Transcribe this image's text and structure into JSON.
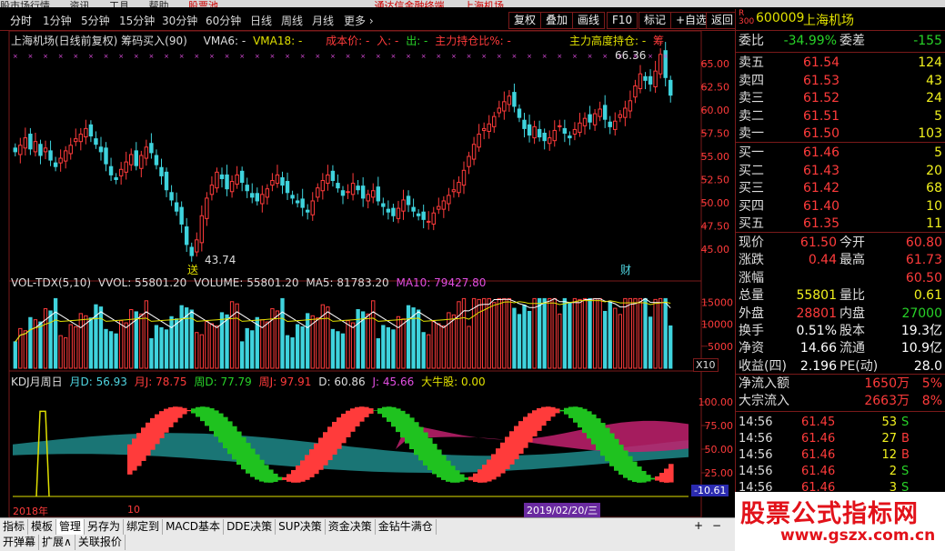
{
  "menu": {
    "items": [
      "股市场行情",
      "资讯",
      "工具",
      "帮助",
      "股票池"
    ],
    "center_items": [
      "通达信金融终端",
      "上海机场"
    ]
  },
  "periods": [
    "分时",
    "1分钟",
    "5分钟",
    "15分钟",
    "30分钟",
    "60分钟",
    "日线",
    "周线",
    "月线",
    "更多 ›"
  ],
  "toolbar": [
    "复权",
    "叠加",
    "画线",
    "F10",
    "标记",
    "+自选",
    "返回"
  ],
  "main_info": {
    "title": "上海机场(日线前复权) 筹码买入(90)",
    "vma6": "VMA6: -",
    "vma18": "VMA18: -",
    "cost": "成本价: -",
    "in": "入: -",
    "out": "出: -",
    "main_ratio": "主力持仓比%: -",
    "main_height": "主力高度持仓: -",
    "chip": "筹"
  },
  "price_axis": [
    "65.00",
    "62.50",
    "60.00",
    "57.50",
    "55.00",
    "52.50",
    "50.00",
    "47.50",
    "45.00"
  ],
  "annotations": {
    "high": "66.36",
    "low": "43.74",
    "low_tag": "送",
    "fin_tag": "财"
  },
  "vol_info": {
    "title": "VOL-TDX(5,10)",
    "vvol": "VVOL: 55801.20",
    "volume": "VOLUME: 55801.20",
    "ma5": "MA5: 81783.20",
    "ma10": "MA10: 79427.80"
  },
  "vol_axis": [
    "15000",
    "10000",
    "5000"
  ],
  "vol_unit": "X10",
  "kdj_info": {
    "title": "KDJ月周日",
    "h": "月D: 56.93",
    "mj": "月J: 78.75",
    "wd": "周D: 77.79",
    "wj": "周J: 97.91",
    "d": "D: 60.86",
    "j": "J: 45.66",
    "bull": "大牛股: 0.00"
  },
  "kdj_axis": [
    "100.00",
    "75.00",
    "50.00",
    "25.00"
  ],
  "kdj_value": "-10.61",
  "date_axis": {
    "year": "2018年",
    "month": "10",
    "cursor_date": "2019/02/20/三"
  },
  "bottom_tabs": [
    "指标",
    "模板",
    "管理",
    "另存为",
    "绑定到",
    "MACD基本",
    "DDE决策",
    "SUP决策",
    "资金决策",
    "金钻牛满仓"
  ],
  "bottom_tabs2": [
    "开弹幕",
    "扩展∧",
    "关联报价"
  ],
  "stock": {
    "code": "600009",
    "name": "上海机场",
    "prefix_r": "R",
    "prefix_300": "300"
  },
  "quote": {
    "webi_label": "委比",
    "webi": "-34.99%",
    "wecha_label": "委差",
    "wecha": "-155",
    "asks": [
      {
        "label": "卖五",
        "price": "61.54",
        "vol": "124"
      },
      {
        "label": "卖四",
        "price": "61.53",
        "vol": "43"
      },
      {
        "label": "卖三",
        "price": "61.52",
        "vol": "24"
      },
      {
        "label": "卖二",
        "price": "61.51",
        "vol": "5"
      },
      {
        "label": "卖一",
        "price": "61.50",
        "vol": "103"
      }
    ],
    "bids": [
      {
        "label": "买一",
        "price": "61.46",
        "vol": "5"
      },
      {
        "label": "买二",
        "price": "61.43",
        "vol": "20"
      },
      {
        "label": "买三",
        "price": "61.42",
        "vol": "68"
      },
      {
        "label": "买四",
        "price": "61.40",
        "vol": "10"
      },
      {
        "label": "买五",
        "price": "61.35",
        "vol": "11"
      }
    ],
    "stats": [
      {
        "l1": "现价",
        "v1": "61.50",
        "c1": "red",
        "l2": "今开",
        "v2": "60.80",
        "c2": "red"
      },
      {
        "l1": "涨跌",
        "v1": "0.44",
        "c1": "red",
        "l2": "最高",
        "v2": "61.73",
        "c2": "red"
      },
      {
        "l1": "涨幅",
        "v1": "",
        "c1": "red",
        "l2": "",
        "v2": "60.50",
        "c2": "red"
      },
      {
        "l1": "总量",
        "v1": "55801",
        "c1": "yellow",
        "l2": "量比",
        "v2": "0.61",
        "c2": "yellow"
      },
      {
        "l1": "外盘",
        "v1": "28801",
        "c1": "red",
        "l2": "内盘",
        "v2": "27000",
        "c2": "green"
      },
      {
        "l1": "换手",
        "v1": "0.51%",
        "c1": "white",
        "l2": "股本",
        "v2": "19.3亿",
        "c2": "white"
      },
      {
        "l1": "净资",
        "v1": "14.66",
        "c1": "white",
        "l2": "流通",
        "v2": "10.9亿",
        "c2": "white"
      },
      {
        "l1": "收益(四)",
        "v1": "2.196",
        "c1": "white",
        "l2": "PE(动)",
        "v2": "28.0",
        "c2": "white"
      }
    ],
    "flows": [
      {
        "label": "净流入额",
        "value": "1650万",
        "pct": "5%"
      },
      {
        "label": "大宗流入",
        "value": "2663万",
        "pct": "8%"
      }
    ],
    "ticks": [
      {
        "time": "14:56",
        "price": "61.45",
        "vol": "53",
        "side": "S"
      },
      {
        "time": "14:56",
        "price": "61.46",
        "vol": "27",
        "side": "B"
      },
      {
        "time": "14:56",
        "price": "61.46",
        "vol": "12",
        "side": "B"
      },
      {
        "time": "14:56",
        "price": "61.46",
        "vol": "2",
        "side": "S"
      },
      {
        "time": "14:56",
        "price": "61.46",
        "vol": "3",
        "side": "S"
      }
    ]
  },
  "brand": {
    "title": "股票公式指标网",
    "url": "www.gszx.com.cn"
  },
  "colors": {
    "up": "#ff3b3b",
    "down": "#3fd3dd",
    "ma": "#ffffff",
    "vma6": "#ffffff",
    "vma18": "#e0e000",
    "frame": "#7a1a1a"
  }
}
